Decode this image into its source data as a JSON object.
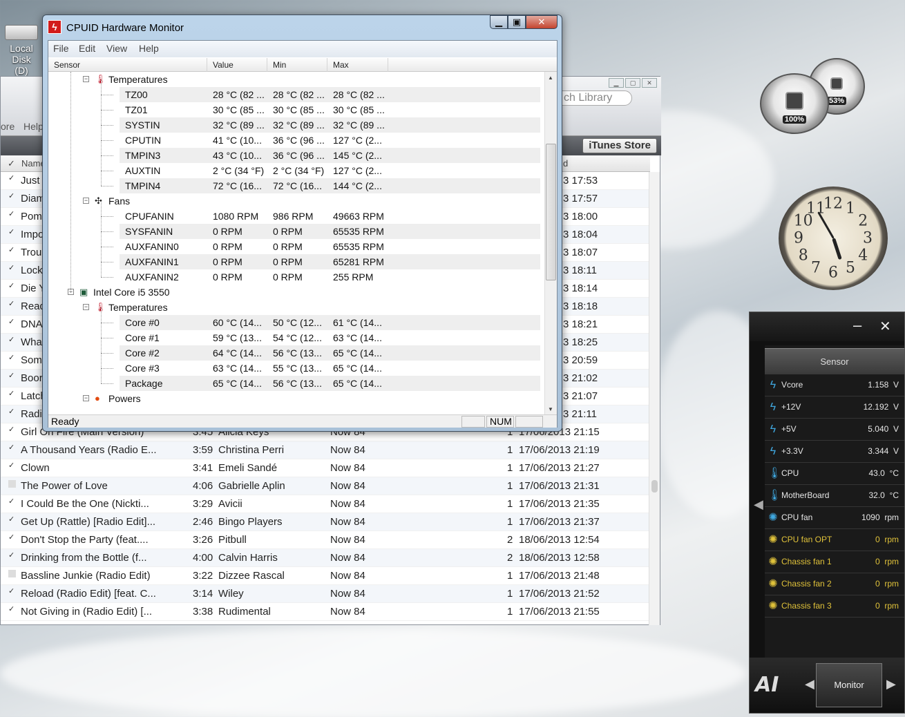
{
  "desktop": {
    "icon_label_line1": "Local Disk",
    "icon_label_line2": "(D)"
  },
  "gadgets": {
    "cpu_meter_pct": "100%",
    "ram_meter_pct": "53%",
    "clock_numbers": [
      "12",
      "1",
      "2",
      "3",
      "4",
      "5",
      "6",
      "7",
      "8",
      "9",
      "10",
      "11"
    ]
  },
  "itunes": {
    "search_placeholder": "ch Library",
    "menu_partial": [
      "ore",
      "Help"
    ],
    "store_button": "iTunes Store",
    "col_name": "Name",
    "col_date_partial": "d",
    "rows_partial": [
      {
        "name": "Just",
        "date": "3 17:53",
        "checked": true
      },
      {
        "name": "Diam",
        "date": "3 17:57",
        "checked": true
      },
      {
        "name": "Pom",
        "date": "3 18:00",
        "checked": true
      },
      {
        "name": "Impo",
        "date": "3 18:04",
        "checked": true
      },
      {
        "name": "Trou",
        "date": "3 18:07",
        "checked": true
      },
      {
        "name": "Lock",
        "date": "3 18:11",
        "checked": true
      },
      {
        "name": "Die Y",
        "date": "3 18:14",
        "checked": true
      },
      {
        "name": "Read",
        "date": "3 18:18",
        "checked": true
      },
      {
        "name": "DNA",
        "date": "3 18:21",
        "checked": true
      },
      {
        "name": "Wha",
        "date": "3 18:25",
        "checked": true
      },
      {
        "name": "Som",
        "date": "3 20:59",
        "checked": true
      },
      {
        "name": "Boor",
        "date": "3 21:02",
        "checked": true
      },
      {
        "name": "Latch",
        "date": "3 21:07",
        "checked": true
      },
      {
        "name": "Radi",
        "date": "3 21:11",
        "checked": true
      }
    ],
    "rows_full": [
      {
        "name": "Girl On Fire (Main Version)",
        "time": "3:45",
        "artist": "Alicia Keys",
        "album": "Now 84",
        "plays": "1",
        "date": "17/06/2013 21:15",
        "checked": true
      },
      {
        "name": "A Thousand Years (Radio E...",
        "time": "3:59",
        "artist": "Christina Perri",
        "album": "Now 84",
        "plays": "1",
        "date": "17/06/2013 21:19",
        "checked": true
      },
      {
        "name": "Clown",
        "time": "3:41",
        "artist": "Emeli Sandé",
        "album": "Now 84",
        "plays": "1",
        "date": "17/06/2013 21:27",
        "checked": true
      },
      {
        "name": "The Power of Love",
        "time": "4:06",
        "artist": "Gabrielle Aplin",
        "album": "Now 84",
        "plays": "1",
        "date": "17/06/2013 21:31",
        "checked": false
      },
      {
        "name": "I Could Be the One (Nickti...",
        "time": "3:29",
        "artist": "Avicii",
        "album": "Now 84",
        "plays": "1",
        "date": "17/06/2013 21:35",
        "checked": true
      },
      {
        "name": "Get Up (Rattle) [Radio Edit]...",
        "time": "2:46",
        "artist": "Bingo Players",
        "album": "Now 84",
        "plays": "1",
        "date": "17/06/2013 21:37",
        "checked": true
      },
      {
        "name": "Don't Stop the Party (feat....",
        "time": "3:26",
        "artist": "Pitbull",
        "album": "Now 84",
        "plays": "2",
        "date": "18/06/2013 12:54",
        "checked": true
      },
      {
        "name": "Drinking from the Bottle (f...",
        "time": "4:00",
        "artist": "Calvin Harris",
        "album": "Now 84",
        "plays": "2",
        "date": "18/06/2013 12:58",
        "checked": true
      },
      {
        "name": "Bassline Junkie (Radio Edit)",
        "time": "3:22",
        "artist": "Dizzee Rascal",
        "album": "Now 84",
        "plays": "1",
        "date": "17/06/2013 21:48",
        "checked": false
      },
      {
        "name": "Reload (Radio Edit) [feat. C...",
        "time": "3:14",
        "artist": "Wiley",
        "album": "Now 84",
        "plays": "1",
        "date": "17/06/2013 21:52",
        "checked": true
      },
      {
        "name": "Not Giving in (Radio Edit) [...",
        "time": "3:38",
        "artist": "Rudimental",
        "album": "Now 84",
        "plays": "1",
        "date": "17/06/2013 21:55",
        "checked": true
      }
    ]
  },
  "hwmonitor": {
    "title": "CPUID Hardware Monitor",
    "logo": "ϟ",
    "menu": [
      "File",
      "Edit",
      "View",
      "Help"
    ],
    "columns": [
      "Sensor",
      "Value",
      "Min",
      "Max"
    ],
    "status_text": "Ready",
    "status_num": "NUM",
    "rows": [
      {
        "type": "group",
        "level": 2,
        "icon": "thermometer-icon",
        "label": "Temperatures"
      },
      {
        "type": "sensor",
        "label": "TZ00",
        "value": "28 °C  (82 ...",
        "min": "28 °C  (82 ...",
        "max": "28 °C  (82 ..."
      },
      {
        "type": "sensor",
        "label": "TZ01",
        "value": "30 °C  (85 ...",
        "min": "30 °C  (85 ...",
        "max": "30 °C  (85 ..."
      },
      {
        "type": "sensor",
        "label": "SYSTIN",
        "value": "32 °C  (89 ...",
        "min": "32 °C  (89 ...",
        "max": "32 °C  (89 ..."
      },
      {
        "type": "sensor",
        "label": "CPUTIN",
        "value": "41 °C  (10...",
        "min": "36 °C  (96 ...",
        "max": "127 °C  (2..."
      },
      {
        "type": "sensor",
        "label": "TMPIN3",
        "value": "43 °C  (10...",
        "min": "36 °C  (96 ...",
        "max": "145 °C  (2..."
      },
      {
        "type": "sensor",
        "label": "AUXTIN",
        "value": "2 °C  (34 °F)",
        "min": "2 °C  (34 °F)",
        "max": "127 °C  (2..."
      },
      {
        "type": "sensor",
        "label": "TMPIN4",
        "value": "72 °C  (16...",
        "min": "72 °C  (16...",
        "max": "144 °C  (2..."
      },
      {
        "type": "group",
        "level": 2,
        "icon": "fan-icon",
        "label": "Fans"
      },
      {
        "type": "sensor",
        "label": "CPUFANIN",
        "value": "1080 RPM",
        "min": "986 RPM",
        "max": "49663 RPM"
      },
      {
        "type": "sensor",
        "label": "SYSFANIN",
        "value": "0 RPM",
        "min": "0 RPM",
        "max": "65535 RPM"
      },
      {
        "type": "sensor",
        "label": "AUXFANIN0",
        "value": "0 RPM",
        "min": "0 RPM",
        "max": "65535 RPM"
      },
      {
        "type": "sensor",
        "label": "AUXFANIN1",
        "value": "0 RPM",
        "min": "0 RPM",
        "max": "65281 RPM"
      },
      {
        "type": "sensor",
        "label": "AUXFANIN2",
        "value": "0 RPM",
        "min": "0 RPM",
        "max": "255 RPM"
      },
      {
        "type": "group",
        "level": 1,
        "icon": "cpu-chip-icon",
        "label": "Intel Core i5 3550"
      },
      {
        "type": "group",
        "level": 2,
        "icon": "thermometer-icon",
        "label": "Temperatures"
      },
      {
        "type": "sensor",
        "label": "Core #0",
        "value": "60 °C  (14...",
        "min": "50 °C  (12...",
        "max": "61 °C  (14..."
      },
      {
        "type": "sensor",
        "label": "Core #1",
        "value": "59 °C  (13...",
        "min": "54 °C  (12...",
        "max": "63 °C  (14..."
      },
      {
        "type": "sensor",
        "label": "Core #2",
        "value": "64 °C  (14...",
        "min": "56 °C  (13...",
        "max": "65 °C  (14..."
      },
      {
        "type": "sensor",
        "label": "Core #3",
        "value": "63 °C  (14...",
        "min": "55 °C  (13...",
        "max": "65 °C  (14..."
      },
      {
        "type": "sensor",
        "label": "Package",
        "value": "65 °C  (14...",
        "min": "56 °C  (13...",
        "max": "65 °C  (14..."
      },
      {
        "type": "group",
        "level": 2,
        "icon": "power-icon",
        "label": "Powers"
      }
    ]
  },
  "aisuite": {
    "header": "Sensor",
    "minimize": "–",
    "close": "✕",
    "logo": "AI",
    "monitor_button": "Monitor",
    "rows": [
      {
        "icon": "voltage-icon",
        "name": "Vcore",
        "value": "1.158",
        "unit": "V",
        "kind": "volt"
      },
      {
        "icon": "voltage-icon",
        "name": "+12V",
        "value": "12.192",
        "unit": "V",
        "kind": "volt"
      },
      {
        "icon": "voltage-icon",
        "name": "+5V",
        "value": "5.040",
        "unit": "V",
        "kind": "volt"
      },
      {
        "icon": "voltage-icon",
        "name": "+3.3V",
        "value": "3.344",
        "unit": "V",
        "kind": "volt"
      },
      {
        "icon": "thermometer-icon",
        "name": "CPU",
        "value": "43.0",
        "unit": "°C",
        "kind": "temp"
      },
      {
        "icon": "thermometer-icon",
        "name": "MotherBoard",
        "value": "32.0",
        "unit": "°C",
        "kind": "temp"
      },
      {
        "icon": "fan-icon",
        "name": "CPU fan",
        "value": "1090",
        "unit": "rpm",
        "kind": "fan"
      },
      {
        "icon": "fan-icon",
        "name": "CPU fan OPT",
        "value": "0",
        "unit": "rpm",
        "kind": "fanoff"
      },
      {
        "icon": "fan-icon",
        "name": "Chassis fan 1",
        "value": "0",
        "unit": "rpm",
        "kind": "fanoff"
      },
      {
        "icon": "fan-icon",
        "name": "Chassis fan 2",
        "value": "0",
        "unit": "rpm",
        "kind": "fanoff"
      },
      {
        "icon": "fan-icon",
        "name": "Chassis fan 3",
        "value": "0",
        "unit": "rpm",
        "kind": "fanoff"
      }
    ],
    "colors": {
      "volt": "#3fa8e0",
      "temp": "#3fa8e0",
      "fan": "#3fa8e0",
      "fanoff": "#e0c23a",
      "text": "#e6e6e6"
    }
  }
}
